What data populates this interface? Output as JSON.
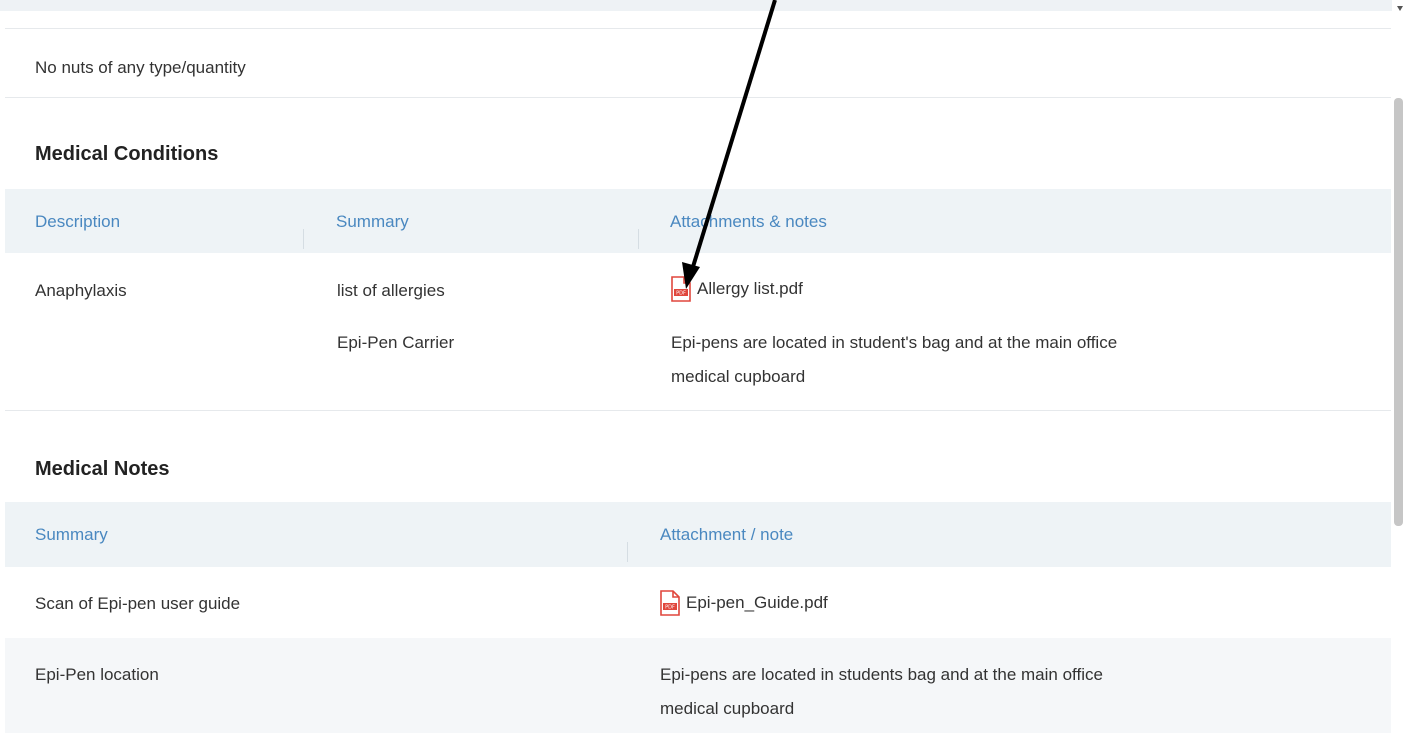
{
  "allergy_note": "No nuts of any type/quantity",
  "medical_conditions": {
    "title": "Medical Conditions",
    "columns": [
      "Description",
      "Summary",
      "Attachments & notes"
    ],
    "row": {
      "description": "Anaphylaxis",
      "summaries": [
        "list of allergies",
        "Epi-Pen Carrier"
      ],
      "attachment": "Allergy list.pdf",
      "note_line1": "Epi-pens are located in student's bag and at the main office",
      "note_line2": "medical cupboard"
    }
  },
  "medical_notes": {
    "title": "Medical Notes",
    "columns": [
      "Summary",
      "Attachment / note"
    ],
    "rows": [
      {
        "summary": "Scan of Epi-pen user guide",
        "attachment": "Epi-pen_Guide.pdf"
      },
      {
        "summary": "Epi-Pen location",
        "note_line1": "Epi-pens are located in students bag and at the main office",
        "note_line2": "medical cupboard"
      }
    ]
  },
  "icons": {
    "pdf": "pdf-file-icon",
    "annotation": "arrow-annotation"
  },
  "colors": {
    "header_text": "#4a88c0",
    "header_bg": "#eef3f6",
    "pdf_red": "#e0473d"
  }
}
